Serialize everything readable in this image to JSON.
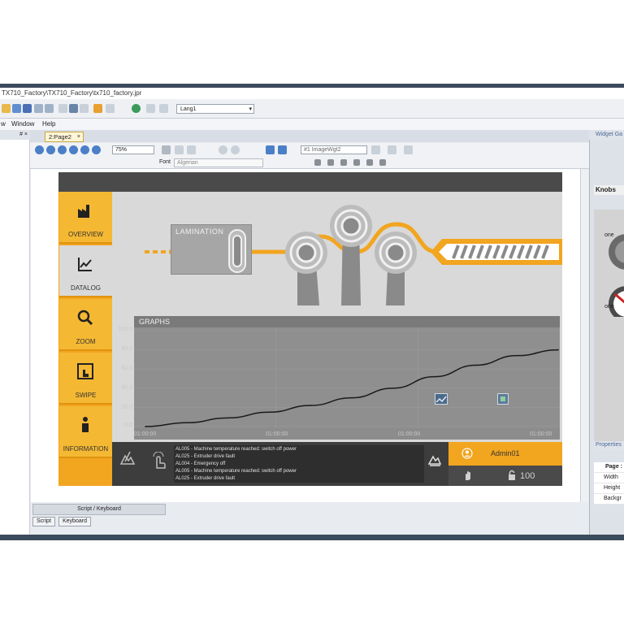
{
  "window": {
    "title": "TX710_Factory\\TX710_Factory\\tx710_factory.jpr",
    "language": "Lang1"
  },
  "menu": [
    "w",
    "Window",
    "Help"
  ],
  "left_panel": {
    "header": "# ×"
  },
  "editor": {
    "tab_label": "2:Page2",
    "zoom": "75%",
    "widget_select": "#1 ImageWgt2",
    "font_label": "Font",
    "font_value": "Algerian"
  },
  "hmi": {
    "nav_items": [
      {
        "label": "OVERVIEW",
        "icon": "factory-icon"
      },
      {
        "label": "DATALOG",
        "icon": "chart-icon"
      },
      {
        "label": "ZOOM",
        "icon": "magnifier-icon"
      },
      {
        "label": "SWIPE",
        "icon": "hand-swipe-icon"
      },
      {
        "label": "INFORMATION",
        "icon": "info-icon"
      }
    ],
    "lamination_label": "LAMINATION",
    "graphs_title": "GRAPHS",
    "alarms": [
      "AL005 - Machine temperature reached: switch off power",
      "AL025 - Extruder drive fault",
      "AL004 - Emergency off",
      "AL005 - Machine temperature reached: switch off power",
      "AL025 - Extruder drive fault"
    ],
    "user_name": "Admin01",
    "user_level": "100",
    "colors": {
      "accent": "#f2a51f",
      "panel": "#4a4a4a",
      "main_bg": "#d9d9d9"
    }
  },
  "chart_data": {
    "type": "line",
    "title": "GRAPHS",
    "xlabel": "",
    "ylabel": "",
    "y_ticks": [
      "100.0",
      "80.0",
      "60.0",
      "40.0",
      "20.0",
      "0.0"
    ],
    "x_ticks": [
      "01:00:00",
      "01:00:00",
      "01:00:00",
      "01:00:00"
    ],
    "ylim": [
      0,
      100
    ],
    "grid": true,
    "x": [
      0,
      1,
      2,
      3,
      4,
      5,
      6,
      7,
      8,
      9,
      10
    ],
    "series": [
      {
        "values": [
          0,
          4,
          9,
          15,
          22,
          30,
          40,
          52,
          64,
          74,
          80
        ]
      }
    ]
  },
  "bottom": {
    "script_panel": "Script / Keyboard",
    "tabs": [
      "Script",
      "Keyboard"
    ]
  },
  "right_panel": {
    "header": "Widget Ga",
    "knobs_label": "Knobs",
    "knob_captions": [
      "one",
      "one"
    ],
    "properties_header": "Properties",
    "property_rows": [
      "Page :",
      "Width",
      "Height",
      "Backgr"
    ]
  }
}
